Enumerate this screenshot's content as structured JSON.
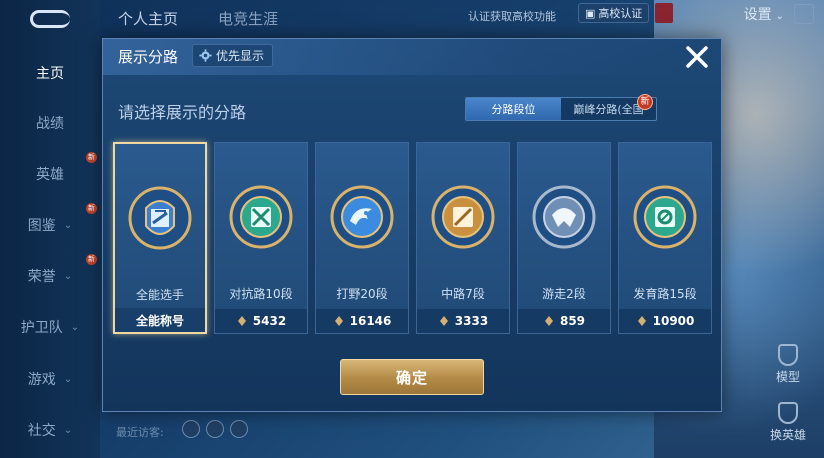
{
  "sidebar": {
    "items": [
      {
        "label": "主页",
        "active": true
      },
      {
        "label": "战绩"
      },
      {
        "label": "英雄"
      },
      {
        "label": "图鉴"
      },
      {
        "label": "荣誉"
      },
      {
        "label": "护卫队"
      },
      {
        "label": "游戏"
      },
      {
        "label": "社交"
      }
    ],
    "new_marker": "新"
  },
  "header": {
    "tabs": [
      "个人主页",
      "电竞生涯"
    ],
    "auth_text": "认证获取高校功能",
    "school_badge": "高校认证",
    "settings": "设置"
  },
  "footer": {
    "recent_visitors": "最近访客:",
    "model": "模型",
    "switch_hero": "换英雄"
  },
  "modal": {
    "title": "展示分路",
    "priority_label": "优先显示",
    "prompt": "请选择展示的分路",
    "toggle": [
      "分路段位",
      "巅峰分路(全国"
    ],
    "new_badge": "新",
    "confirm_label": "确定",
    "cards": [
      {
        "title": "全能选手",
        "foot": "全能称号",
        "selected": true,
        "icon": "all-round-icon"
      },
      {
        "title": "对抗路10段",
        "foot": "5432",
        "icon": "clash-lane-icon"
      },
      {
        "title": "打野20段",
        "foot": "16146",
        "icon": "jungle-icon"
      },
      {
        "title": "中路7段",
        "foot": "3333",
        "icon": "mid-lane-icon"
      },
      {
        "title": "游走2段",
        "foot": "859",
        "icon": "roam-icon"
      },
      {
        "title": "发育路15段",
        "foot": "10900",
        "icon": "farm-lane-icon"
      }
    ]
  },
  "colors": {
    "accent_gold": "#d4b173",
    "active_toggle": "#3a78c0",
    "panel": "#1a4370"
  }
}
